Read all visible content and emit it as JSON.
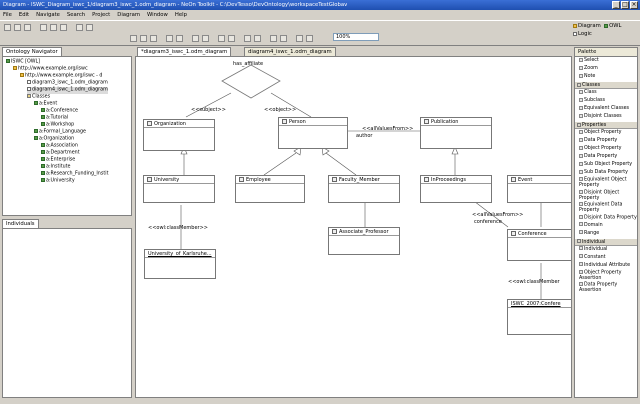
{
  "window": {
    "title": "Diagram - ISWC_Diagram_iswc_1/diagram3_iswc_1.odm_diagram - NeOn Toolkit - C:\\DevTesso\\DevOntology\\workspaceTestGlobav"
  },
  "menu": [
    "File",
    "Edit",
    "Navigate",
    "Search",
    "Project",
    "Diagram",
    "Window",
    "Help"
  ],
  "zoom": "100%",
  "perspectives": {
    "first": "Diagram",
    "second": "OWL",
    "third": "Logic"
  },
  "tabs": {
    "editor1": "*diagram3_iswc_1.odm_diagram",
    "editor2": "diagram4_iswc_1.odm_diagram",
    "navigator": "Ontology Navigator",
    "individuals": "Individuals",
    "palette": "Palette"
  },
  "navigator": {
    "tree": [
      "ISWC [OWL]",
      "http://www.example.org/iswc",
      "http://www.example.org/iswc - d",
      "diagram3_iswc_1.odm_diagram",
      "diagram4_iswc_1.odm_diagram",
      "Classes",
      "a:Event",
      "a:Conference",
      "a:Tutorial",
      "a:Workshop",
      "a:Formal_Language",
      "a:Organization",
      "a:Association",
      "a:Department",
      "a:Enterprise",
      "a:Institute",
      "a:Research_Funding_Instit",
      "a:University"
    ]
  },
  "diagram": {
    "nodes": {
      "organization": "Organization",
      "person": "Person",
      "publication": "Publication",
      "university": "University",
      "employee": "Employee",
      "faculty_member": "Faculty_Member",
      "inproceedings": "InProceedings",
      "event": "Event",
      "associate_professor": "Associate_Professor",
      "conference": "Conference",
      "univ_karlsruhe": "University_of_Karlsruhe...",
      "iswc2007": "ISWC_2007:Confere"
    },
    "labels": {
      "has_affiliation": "has_affiliate",
      "subject": "<<subject>>",
      "object": "<<object>>",
      "all_values_from": "<<allValuesFrom>>",
      "author": "author",
      "class_member1": "<<owl:classMember>>",
      "all_values_from2": "<<allValuesFrom>>",
      "conference_lbl": "conference",
      "class_member2": "<<owl:classMember"
    }
  },
  "palette": {
    "top": [
      "Select",
      "Zoom",
      "Note"
    ],
    "sections": [
      {
        "title": "Classes",
        "items": [
          "Class",
          "Subclass",
          "Equivalent Classes",
          "Disjoint Classes"
        ]
      },
      {
        "title": "Properties",
        "items": [
          "Object Property",
          "Data Property",
          "Object Property",
          "Data Property",
          "Sub Object Property",
          "Sub Data Property",
          "Equivalent Object Property",
          "Disjoint Object Property",
          "Equivalent Data Property",
          "Disjoint Data Property",
          "Domain",
          "Range"
        ]
      },
      {
        "title": "Individual",
        "items": [
          "Individual",
          "Constant",
          "Individual Attribute",
          "Object Property Assertion",
          "Data Property Assertion"
        ]
      }
    ]
  }
}
